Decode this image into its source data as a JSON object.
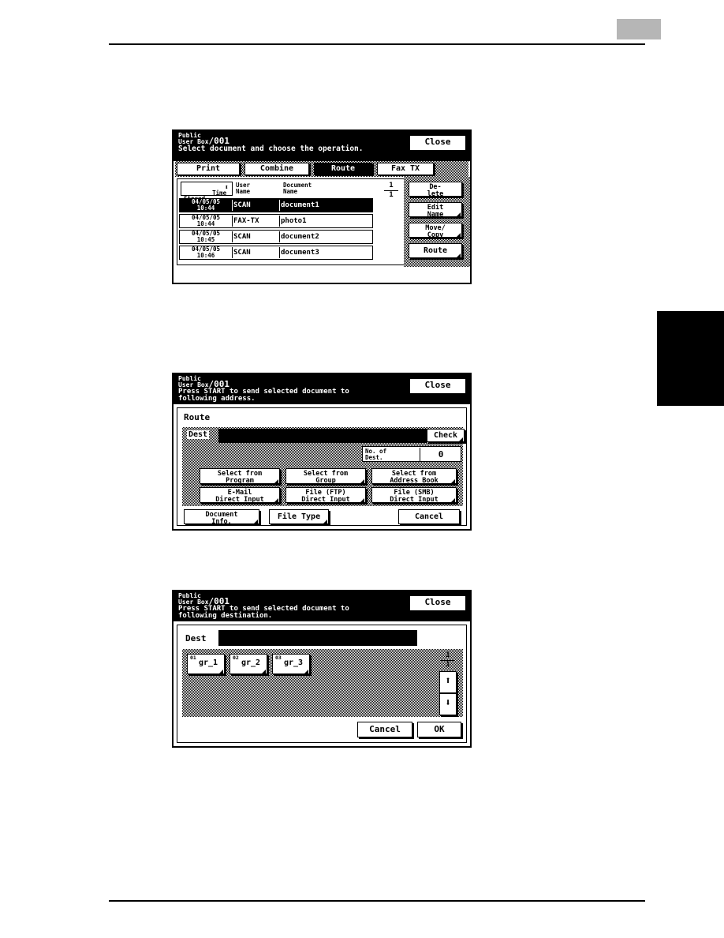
{
  "page": {
    "corner_mark": "",
    "thumb_tab": ""
  },
  "panel1": {
    "header": {
      "title_line1": "Public",
      "title_line2": "User Box",
      "box_number": "/001",
      "subtitle": "Select document and choose the operation.",
      "close_label": "Close"
    },
    "tabs": [
      {
        "label": "Print",
        "selected": false
      },
      {
        "label": "Combine",
        "selected": false
      },
      {
        "label": "Route",
        "selected": true
      },
      {
        "label": "Fax TX",
        "selected": false
      }
    ],
    "list": {
      "sort_button": "Time\nStored",
      "sort_arrows": "⬍",
      "col_user": "User\nName",
      "col_doc": "Document\nName",
      "page_current": "1",
      "page_total": "1",
      "rows": [
        {
          "time": "04/05/05\n10:44",
          "user": "SCAN",
          "doc": "document1",
          "selected": true
        },
        {
          "time": "04/05/05\n10:44",
          "user": "FAX-TX",
          "doc": "photo1",
          "selected": false
        },
        {
          "time": "04/05/05\n10:45",
          "user": "SCAN",
          "doc": "document2",
          "selected": false
        },
        {
          "time": "04/05/05\n10:46",
          "user": "SCAN",
          "doc": "document3",
          "selected": false
        }
      ],
      "scroll_up": "⬆",
      "scroll_down": "⬇"
    },
    "side_buttons": [
      {
        "label": "De-\nlete",
        "corner": false
      },
      {
        "label": "Edit\nName",
        "corner": true
      },
      {
        "label": "Move/\nCopy",
        "corner": true
      },
      {
        "label": "Route",
        "corner": true
      }
    ]
  },
  "panel2": {
    "header": {
      "title_line1": "Public",
      "title_line2": "User Box",
      "box_number": "/001",
      "subtitle": "Press START to send selected document to\nfollowing address.",
      "close_label": "Close"
    },
    "section_label": "Route",
    "dest_label": "Dest",
    "dest_value": "",
    "check_label": "Check",
    "no_of_dest_label": "No. of\nDest.",
    "no_of_dest_value": "0",
    "grid_buttons": [
      {
        "label": "Select from\nProgram"
      },
      {
        "label": "Select from\nGroup"
      },
      {
        "label": "Select from\nAddress Book"
      },
      {
        "label": "E-Mail\nDirect Input"
      },
      {
        "label": "File (FTP)\nDirect Input"
      },
      {
        "label": "File (SMB)\nDirect Input"
      }
    ],
    "bottom_buttons": [
      {
        "label": "Document\nInfo.",
        "corner": true
      },
      {
        "label": "File Type",
        "corner": true
      },
      {
        "label": "Cancel",
        "corner": false
      }
    ]
  },
  "panel3": {
    "header": {
      "title_line1": "Public",
      "title_line2": "User Box",
      "box_number": "/001",
      "subtitle": "Press START to send selected document to\nfollowing destination.",
      "close_label": "Close"
    },
    "dest_label": "Dest",
    "dest_value": "",
    "groups": [
      {
        "index": "01",
        "name": "gr_1"
      },
      {
        "index": "02",
        "name": "gr_2"
      },
      {
        "index": "03",
        "name": "gr_3"
      }
    ],
    "page_current": "1",
    "page_total": "1",
    "scroll_up": "⬆",
    "scroll_down": "⬇",
    "cancel_label": "Cancel",
    "ok_label": "OK"
  }
}
